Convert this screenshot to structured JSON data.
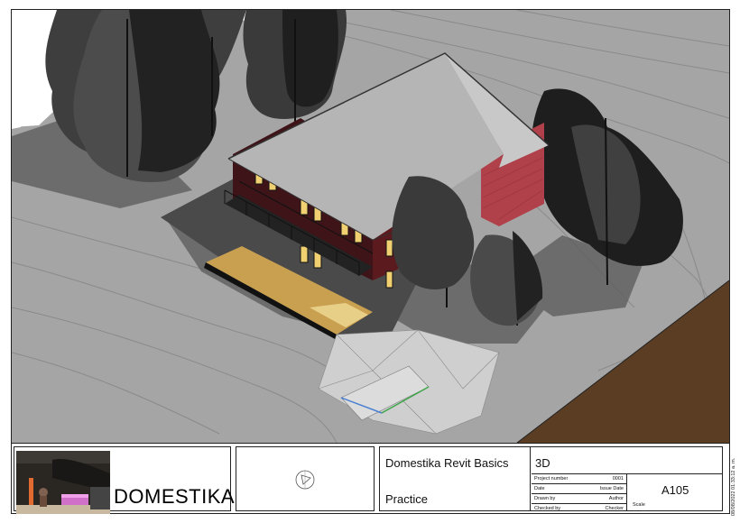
{
  "view": {
    "name": "3D",
    "colors": {
      "background": "#ffffff",
      "ground": "#a8a8a8",
      "terrain_line": "#8c8c8c",
      "shadow": "#4a4a4a",
      "tree_dark": "#1e1e1e",
      "tree_mid": "#3a3a3a",
      "roof": "#b5b5b5",
      "brick": "#5a1a1e",
      "brick_light": "#b0404a",
      "deck": "#c9a050",
      "earth": "#5b3d24",
      "path_blue": "#4a7fd1",
      "path_green": "#3fa64a"
    }
  },
  "title_block": {
    "logo_text": "DOMESTIKA",
    "project_name": "Domestika Revit Basics",
    "project_sub": "Practice",
    "sheet_name": "3D",
    "fields": [
      {
        "label": "Project number",
        "value": "0001"
      },
      {
        "label": "Date",
        "value": "Issue Date"
      },
      {
        "label": "Drawn by",
        "value": "Author"
      },
      {
        "label": "Checked by",
        "value": "Checker"
      }
    ],
    "sheet_number": "A105",
    "scale_label": "Scale",
    "timestamp": "08/08/2022 01:33:12 a. m."
  }
}
